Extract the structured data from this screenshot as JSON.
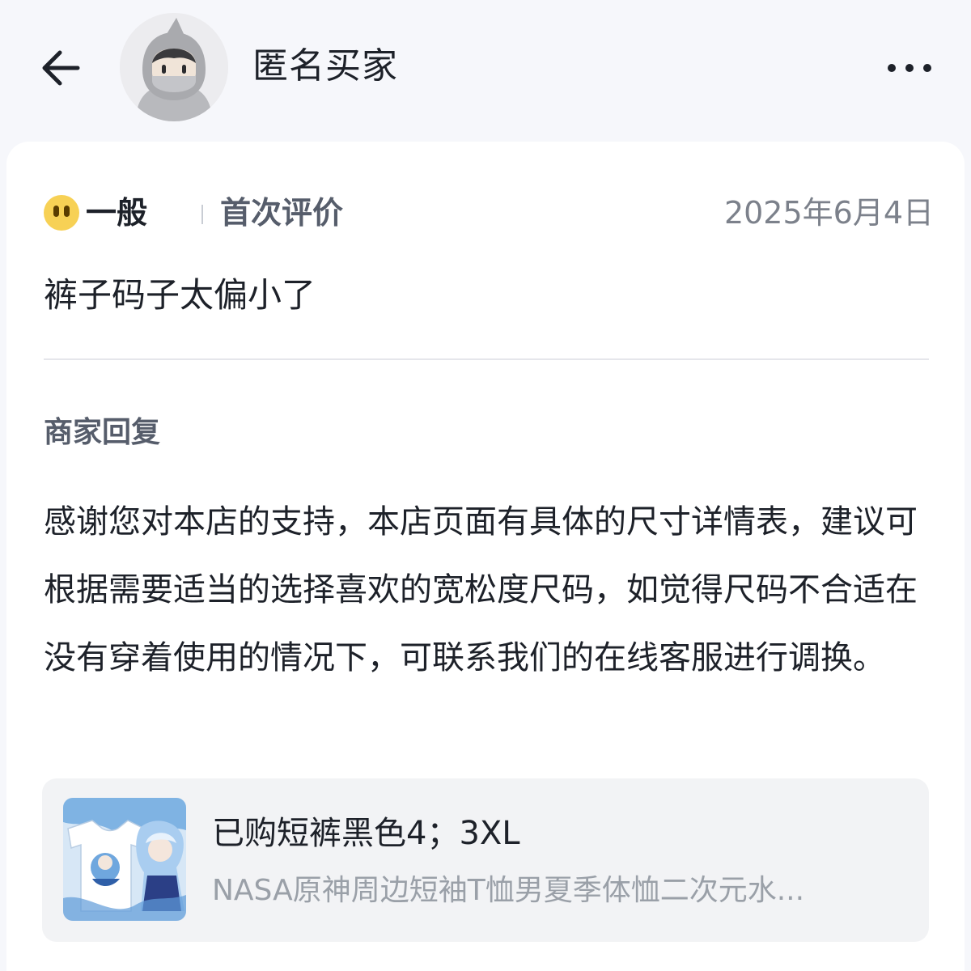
{
  "header": {
    "username": "匿名买家",
    "back_icon": "back-arrow-icon",
    "more_icon": "more-dots-icon"
  },
  "review": {
    "rating_icon": "neutral-face-icon",
    "rating_label": "一般",
    "badge": "首次评价",
    "date": "2025年6月4日",
    "text": "裤子码子太偏小了"
  },
  "merchant_reply": {
    "title": "商家回复",
    "text": "感谢您对本店的支持，本店页面有具体的尺寸详情表，建议可根据需要适当的选择喜欢的宽松度尺码，如觉得尺码不合适在没有穿着使用的情况下，可联系我们的在线客服进行调换。"
  },
  "product": {
    "spec": "已购短裤黑色4；3XL",
    "title": "NASA原神周边短袖T恤男夏季体恤二次元水..."
  },
  "colors": {
    "background": "#f6f7fb",
    "card": "#ffffff",
    "text_primary": "#1d2129",
    "text_secondary": "#565d6b",
    "text_muted": "#9aa0a8",
    "emoji": "#f7d155"
  }
}
